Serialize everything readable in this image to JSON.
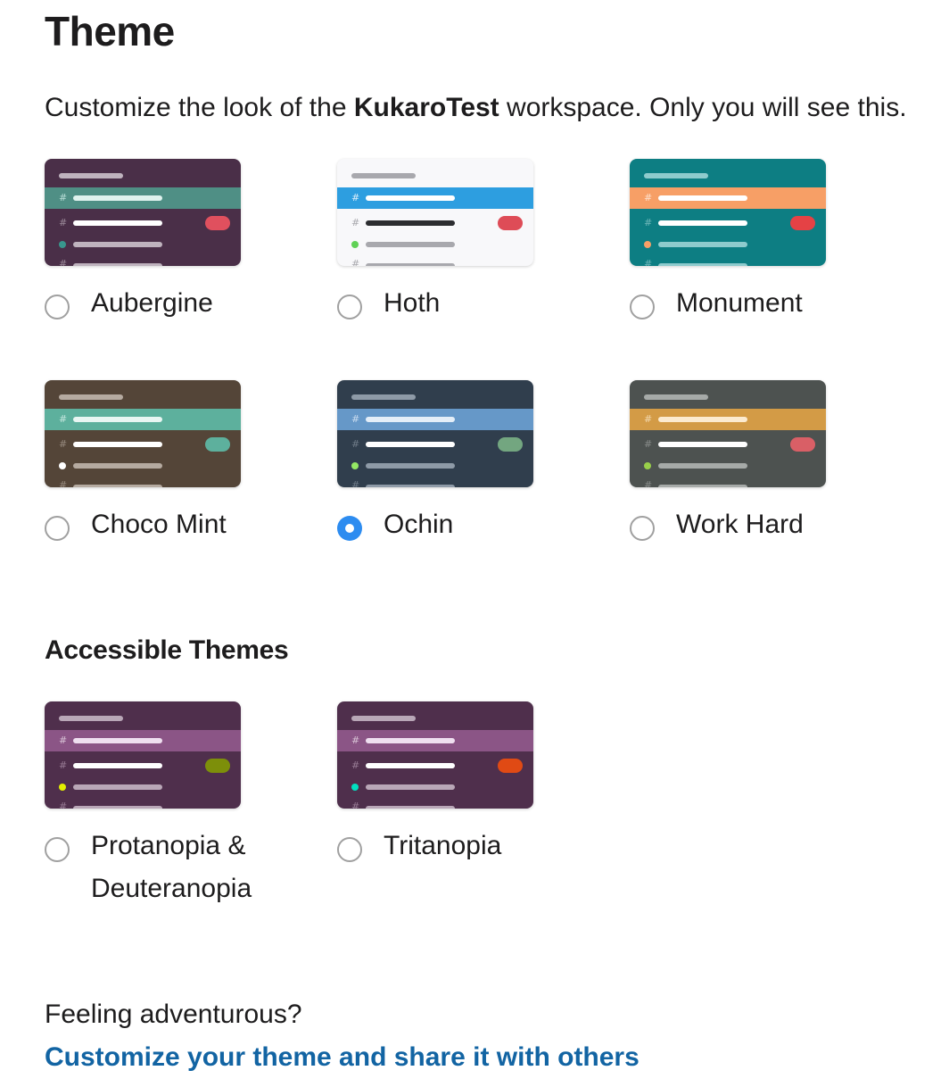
{
  "heading": "Theme",
  "description": {
    "before": "Customize the look of the ",
    "workspace": "KukaroTest",
    "after": " workspace. Only you will see this."
  },
  "themes": [
    {
      "label": "Aubergine",
      "selected": false,
      "colors": {
        "bg": "#4a2f48",
        "hl": "#4f8f85",
        "top": "#bfb3be",
        "hlbar": "#dff2ee",
        "bar": "#ffffff",
        "muted": "#bfb3be",
        "hash": "#9b8a99",
        "hlhash": "#b8ddd6",
        "pill": "#e0505e",
        "dot": "#38978d"
      }
    },
    {
      "label": "Hoth",
      "selected": false,
      "colors": {
        "bg": "#f8f8fa",
        "hl": "#2d9ee0",
        "top": "#a8a8ad",
        "hlbar": "#ffffff",
        "bar": "#2c2d30",
        "muted": "#a8a8ad",
        "hash": "#a8a8ad",
        "hlhash": "#dceefa",
        "pill": "#de4c57",
        "dot": "#60d156"
      }
    },
    {
      "label": "Monument",
      "selected": false,
      "colors": {
        "bg": "#0d7e83",
        "hl": "#f79f66",
        "top": "#8ecbcd",
        "hlbar": "#ffffff",
        "bar": "#ffffff",
        "muted": "#8ecbcd",
        "hash": "#6fb7b9",
        "hlhash": "#fde0cc",
        "pill": "#e54245",
        "dot": "#f79f66"
      }
    },
    {
      "label": "Choco Mint",
      "selected": false,
      "colors": {
        "bg": "#544538",
        "hl": "#5db09d",
        "top": "#b5aaa0",
        "hlbar": "#e9f6f3",
        "bar": "#ffffff",
        "muted": "#b5aaa0",
        "hash": "#968a7e",
        "hlhash": "#c4e6de",
        "pill": "#5db09d",
        "dot": "#ffffff"
      }
    },
    {
      "label": "Ochin",
      "selected": true,
      "colors": {
        "bg": "#303e4d",
        "hl": "#6698c8",
        "top": "#8e9aa7",
        "hlbar": "#e4eef8",
        "bar": "#ffffff",
        "muted": "#8e9aa7",
        "hash": "#6f7b88",
        "hlhash": "#c9dcef",
        "pill": "#73a680",
        "dot": "#94e864"
      }
    },
    {
      "label": "Work Hard",
      "selected": false,
      "colors": {
        "bg": "#4d5250",
        "hl": "#d39b46",
        "top": "#a6aaa8",
        "hlbar": "#fcebd0",
        "bar": "#ffffff",
        "muted": "#a6aaa8",
        "hash": "#888c8a",
        "hlhash": "#f2d8ae",
        "pill": "#d95f66",
        "dot": "#99d04a"
      }
    }
  ],
  "accessible_heading": "Accessible Themes",
  "accessible_themes": [
    {
      "label": "Protanopia &",
      "label2": "Deuteranopia",
      "selected": false,
      "colors": {
        "bg": "#4f2f4c",
        "hl": "#8b5586",
        "top": "#b9a7b7",
        "hlbar": "#efdff0",
        "bar": "#ffffff",
        "muted": "#b9a7b7",
        "hash": "#987c95",
        "hlhash": "#d8c3d6",
        "pill": "#7d8f0a",
        "dot": "#e2ee00"
      }
    },
    {
      "label": "Tritanopia",
      "label2": "",
      "selected": false,
      "colors": {
        "bg": "#4f2f4c",
        "hl": "#8b5586",
        "top": "#b9a7b7",
        "hlbar": "#efdff0",
        "bar": "#ffffff",
        "muted": "#b9a7b7",
        "hash": "#987c95",
        "hlhash": "#d8c3d6",
        "pill": "#e04a14",
        "dot": "#00e0c0"
      }
    }
  ],
  "footer": {
    "question": "Feeling adventurous?",
    "link": "Customize your theme and share it with others"
  }
}
